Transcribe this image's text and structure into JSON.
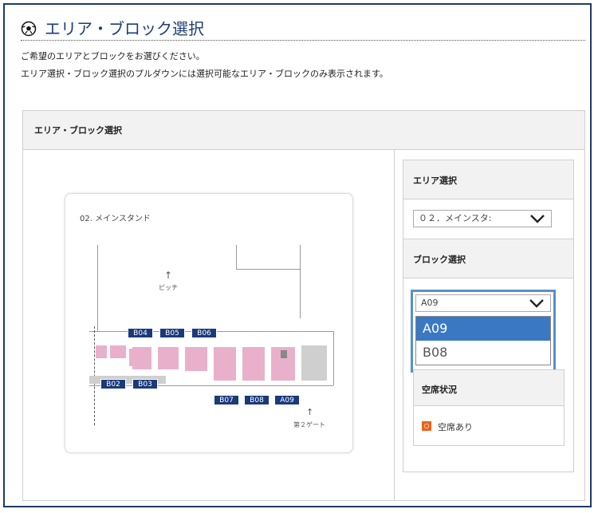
{
  "page": {
    "title": "エリア・ブロック選択",
    "title_icon": "soccer-ball-icon",
    "description_line1": "ご希望のエリアとブロックをお選びください。",
    "description_line2": "エリア選択・ブロック選択のプルダウンには選択可能なエリア・ブロックのみ表示されます。"
  },
  "panel": {
    "header": "エリア・ブロック選択"
  },
  "map": {
    "stand_name": "02. メインスタンド",
    "pitch_label": "ピッチ",
    "gate_label": "第２ゲート",
    "blocks_top": [
      "B04",
      "B05",
      "B06"
    ],
    "blocks_left": [
      "B02",
      "B03"
    ],
    "blocks_bottom": [
      "B07",
      "B08",
      "A09"
    ],
    "colors": {
      "available": "#e9b0cc",
      "unavailable": "#cfcfcf",
      "label_bg": "#1a3a7a"
    }
  },
  "area_select": {
    "header": "エリア選択",
    "value": "０２．メインスタ:"
  },
  "block_select": {
    "header": "ブロック選択",
    "value": "A09",
    "options": [
      "A09",
      "B08"
    ],
    "selected_index": 0
  },
  "seat_status": {
    "header": "空席状況",
    "badge": "○",
    "text": "空席あり",
    "badge_color": "#e8641c"
  }
}
